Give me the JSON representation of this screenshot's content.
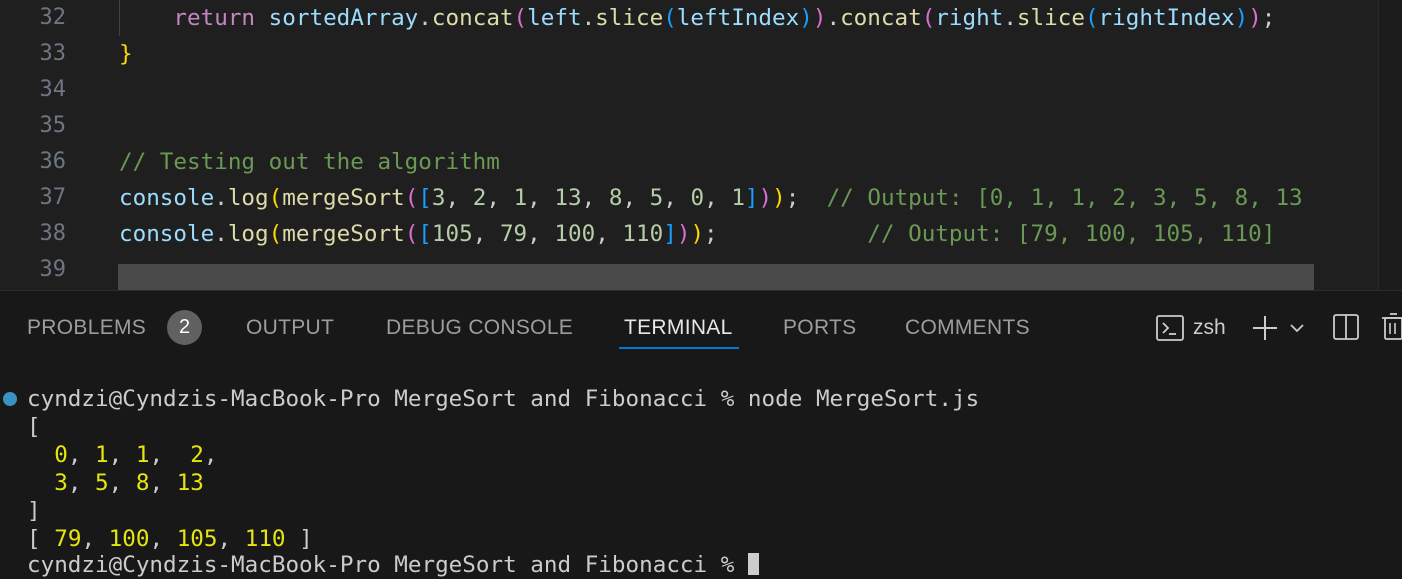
{
  "editor": {
    "line_numbers": [
      "32",
      "33",
      "34",
      "35",
      "36",
      "37",
      "38",
      "39"
    ],
    "line32": {
      "indent": "    ",
      "return": "return",
      "sorted": "sortedArray",
      "concat1": "concat",
      "left": "left",
      "slice1": "slice",
      "leftIndex": "leftIndex",
      "concat2": "concat",
      "right": "right",
      "slice2": "slice",
      "rightIndex": "rightIndex"
    },
    "line33_brace": "}",
    "line36_comment": "// Testing out the algorithm",
    "line37": {
      "console": "console",
      "log": "log",
      "mergeSort": "mergeSort",
      "nums": [
        "3",
        "2",
        "1",
        "13",
        "8",
        "5",
        "0",
        "1"
      ],
      "comment": "// Output: [0, 1, 1, 2, 3, 5, 8, 13"
    },
    "line38": {
      "console": "console",
      "log": "log",
      "mergeSort": "mergeSort",
      "nums": [
        "105",
        "79",
        "100",
        "110"
      ],
      "comment": "// Output: [79, 100, 105, 110]"
    }
  },
  "panel": {
    "tabs": {
      "problems": "PROBLEMS",
      "problems_count": "2",
      "output": "OUTPUT",
      "debug_console": "DEBUG CONSOLE",
      "terminal": "TERMINAL",
      "ports": "PORTS",
      "comments": "COMMENTS"
    },
    "active_tab": "TERMINAL",
    "shell_name": "zsh",
    "icons": {
      "shell": "terminal-prompt-icon",
      "add": "plus-icon",
      "dropdown": "chevron-down-icon",
      "split": "split-terminal-icon",
      "kill": "trash-icon"
    }
  },
  "terminal": {
    "prompt_command": "cyndzi@Cyndzis-MacBook-Pro MergeSort and Fibonacci % node MergeSort.js",
    "open_bracket": "[",
    "row1": [
      "0",
      "1",
      "1",
      "2"
    ],
    "row2": [
      "3",
      "5",
      "8",
      "13"
    ],
    "close_bracket": "]",
    "second_result": [
      "79",
      "100",
      "105",
      "110"
    ],
    "next_prompt_partial": "cyndzi@Cyndzis-MacBook-Pro MergeSort and Fibonacci % "
  },
  "colors": {
    "editor_bg": "#1f1f1f",
    "panel_bg": "#181818",
    "accent": "#0078d4",
    "terminal_number": "#e5e510"
  }
}
